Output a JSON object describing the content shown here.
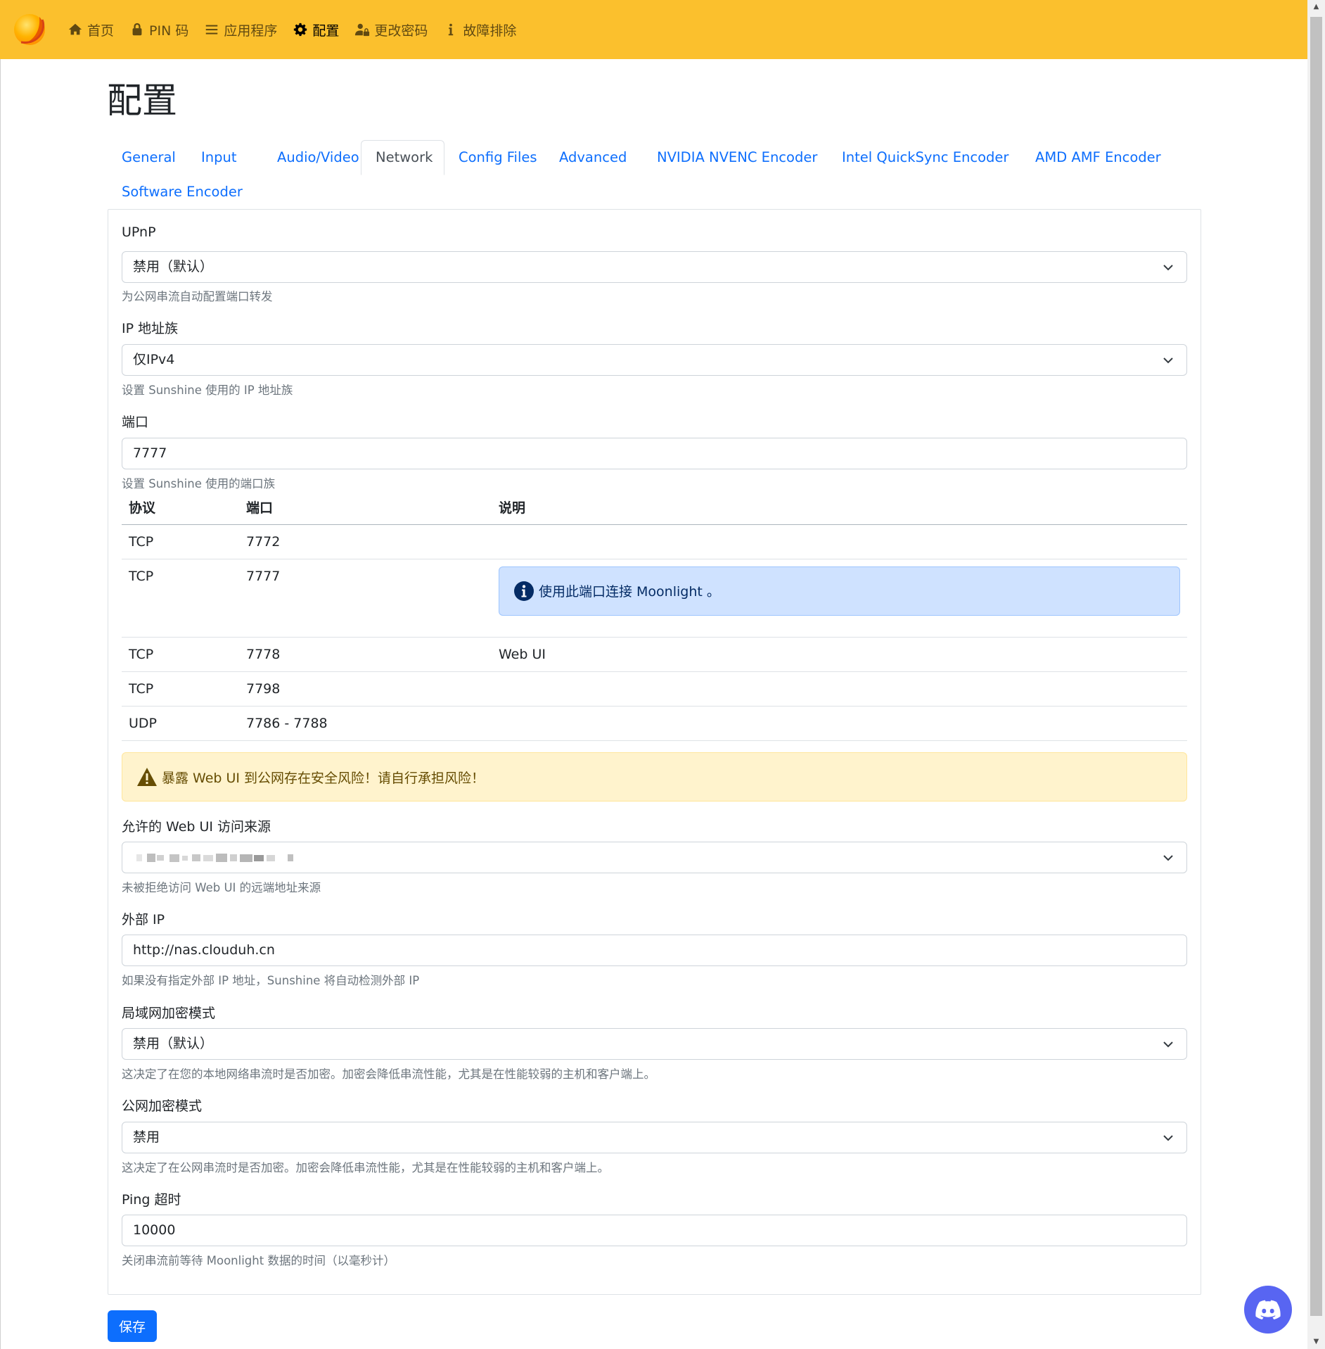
{
  "nav": {
    "items": [
      {
        "label": "首页",
        "icon": "home-icon"
      },
      {
        "label": "PIN 码",
        "icon": "lock-icon"
      },
      {
        "label": "应用程序",
        "icon": "list-icon"
      },
      {
        "label": "配置",
        "icon": "gear-icon",
        "active": true
      },
      {
        "label": "更改密码",
        "icon": "user-lock-icon"
      },
      {
        "label": "故障排除",
        "icon": "info-icon"
      }
    ],
    "background": "#fbc02d"
  },
  "page": {
    "title": "配置"
  },
  "tabs": [
    "General",
    "Input",
    "Audio/Video",
    "Network",
    "Config Files",
    "Advanced",
    "NVIDIA NVENC Encoder",
    "Intel QuickSync Encoder",
    "AMD AMF Encoder",
    "Software Encoder"
  ],
  "active_tab": "Network",
  "upnp": {
    "label": "UPnP",
    "value": "禁用（默认）",
    "help": "为公网串流自动配置端口转发"
  },
  "address_family": {
    "label": "IP 地址族",
    "value": "仅IPv4",
    "help": "设置 Sunshine 使用的 IP 地址族"
  },
  "port": {
    "label": "端口",
    "value": "7777",
    "help": "设置 Sunshine 使用的端口族"
  },
  "ports_table": {
    "headers": [
      "协议",
      "端口",
      "说明"
    ],
    "rows": [
      {
        "protocol": "TCP",
        "port": "7772",
        "note": ""
      },
      {
        "protocol": "TCP",
        "port": "7777",
        "note": "使用此端口连接 Moonlight 。"
      },
      {
        "protocol": "TCP",
        "port": "7778",
        "note": "Web UI"
      },
      {
        "protocol": "TCP",
        "port": "7798",
        "note": ""
      },
      {
        "protocol": "UDP",
        "port": "7786 - 7788",
        "note": ""
      }
    ]
  },
  "warning": {
    "text": "暴露 Web UI 到公网存在安全风险！请自行承担风险！"
  },
  "origin_web_ui": {
    "label": "允许的 Web UI 访问来源",
    "help": "未被拒绝访问 Web UI 的远端地址来源"
  },
  "external_ip": {
    "label": "外部 IP",
    "value": "http://nas.clouduh.cn",
    "help": "如果没有指定外部 IP 地址，Sunshine 将自动检测外部 IP"
  },
  "lan_encryption": {
    "label": "局域网加密模式",
    "value": "禁用（默认）",
    "help": "这决定了在您的本地网络串流时是否加密。加密会降低串流性能，尤其是在性能较弱的主机和客户端上。"
  },
  "wan_encryption": {
    "label": "公网加密模式",
    "value": "禁用",
    "help": "这决定了在公网串流时是否加密。加密会降低串流性能，尤其是在性能较弱的主机和客户端上。"
  },
  "ping_timeout": {
    "label": "Ping 超时",
    "value": "10000",
    "help": "关闭串流前等待 Moonlight 数据的时间（以毫秒计）"
  },
  "save_label": "保存"
}
